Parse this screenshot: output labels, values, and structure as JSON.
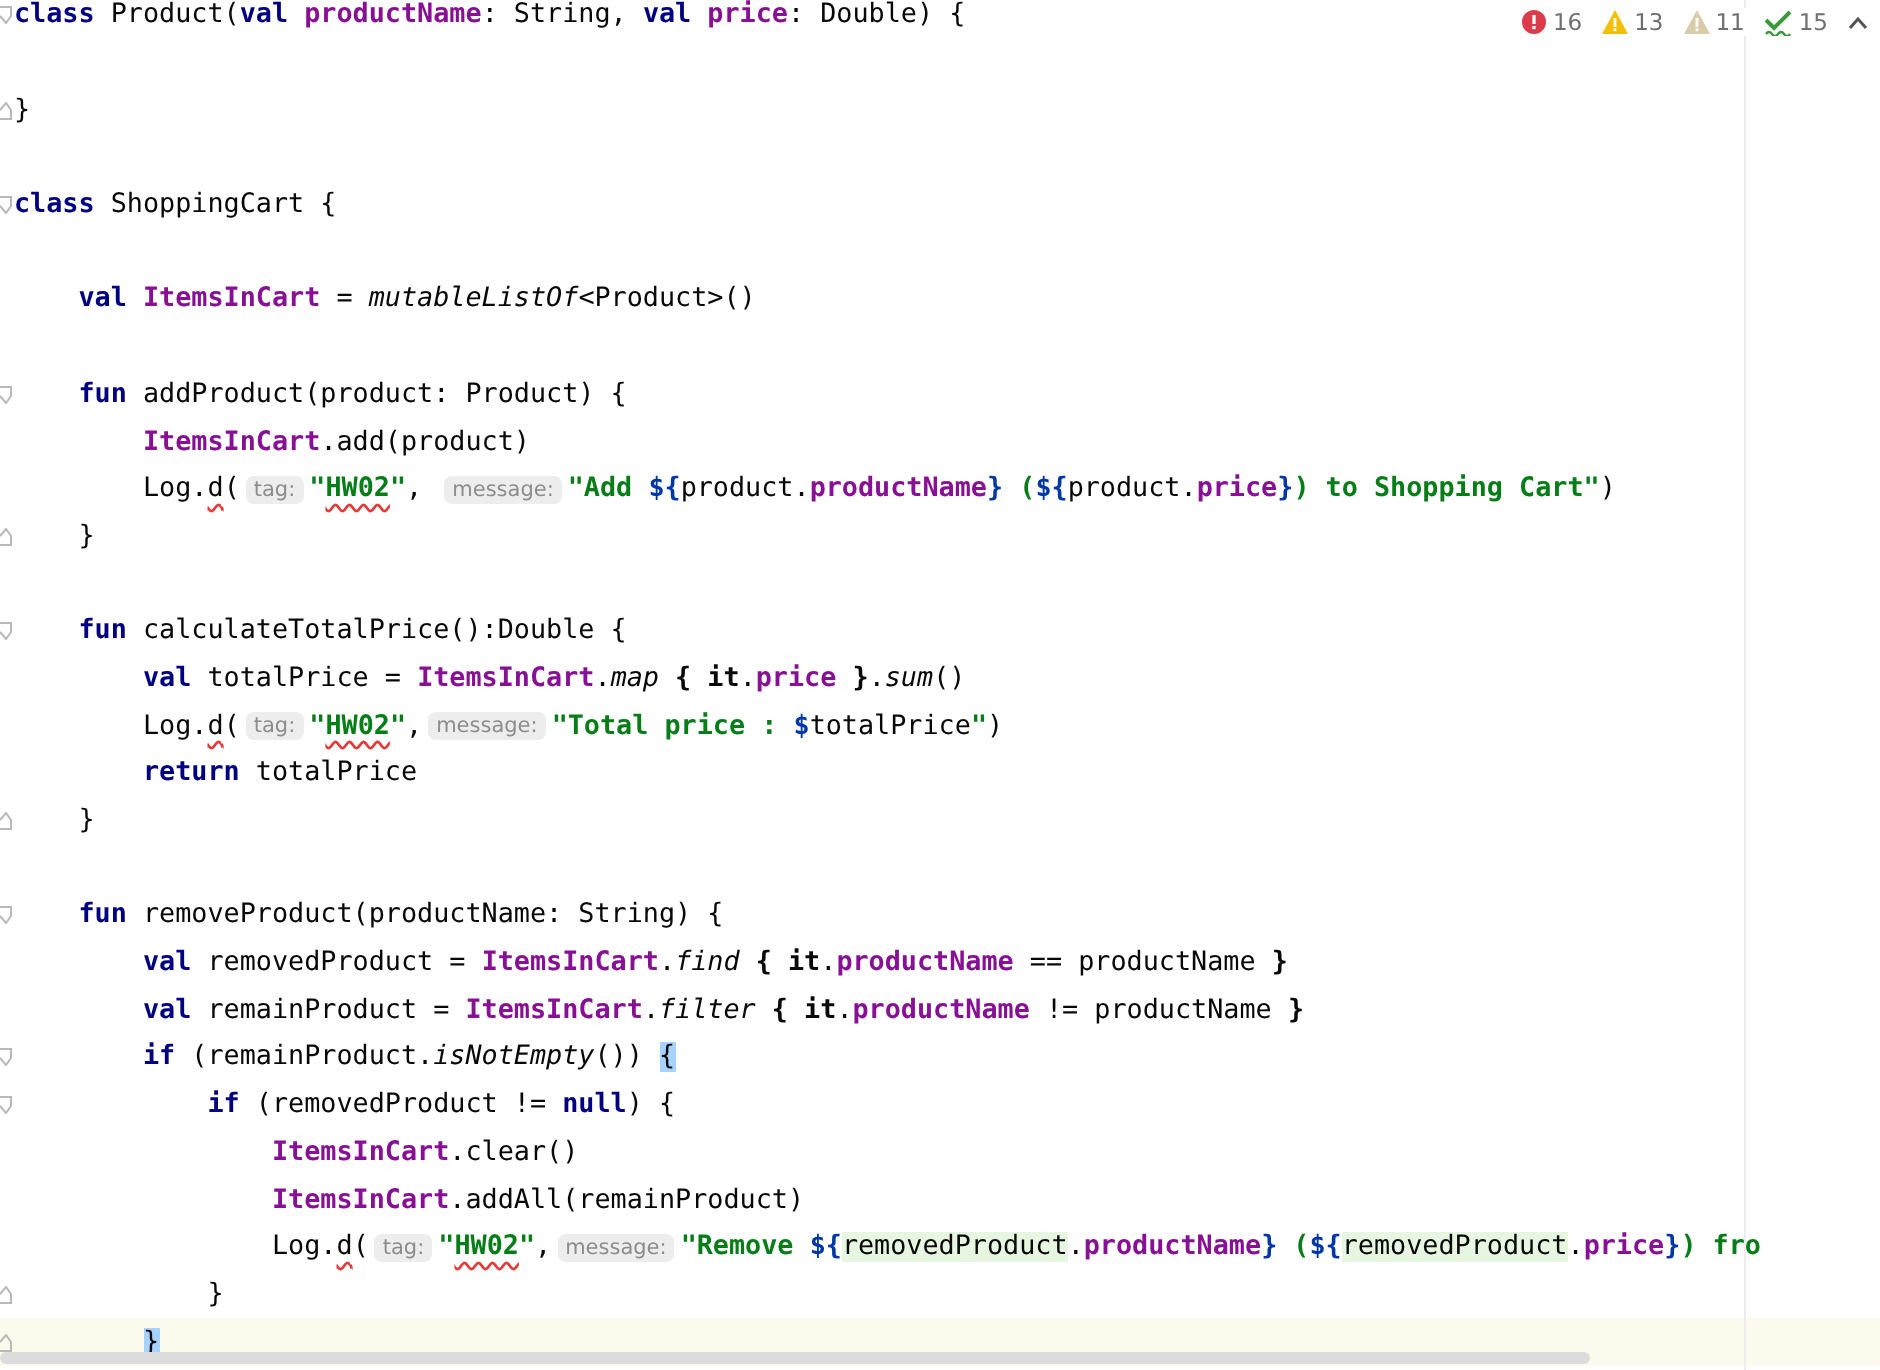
{
  "inspections": [
    {
      "kind": "error",
      "count": "16"
    },
    {
      "kind": "warning",
      "count": "13"
    },
    {
      "kind": "weak",
      "count": "11"
    },
    {
      "kind": "typo",
      "count": "15"
    }
  ],
  "lines": [
    {
      "fold_start": true,
      "fold_end": false,
      "current": false,
      "tokens": [
        {
          "kind": "kw",
          "text": "class"
        },
        {
          "kind": "plain",
          "text": " Product("
        },
        {
          "kind": "kw",
          "text": "val"
        },
        {
          "kind": "member",
          "text": " productName"
        },
        {
          "kind": "plain",
          "text": ": String, "
        },
        {
          "kind": "kw",
          "text": "val"
        },
        {
          "kind": "member",
          "text": " price"
        },
        {
          "kind": "plain",
          "text": ": Double) {"
        }
      ]
    },
    {
      "fold_start": false,
      "fold_end": false,
      "current": false
    },
    {
      "fold_start": false,
      "fold_end": true,
      "current": false,
      "tokens": [
        {
          "kind": "plain",
          "text": "}"
        }
      ]
    },
    {
      "fold_start": false,
      "fold_end": false,
      "current": false
    },
    {
      "fold_start": true,
      "fold_end": false,
      "current": false,
      "tokens": [
        {
          "kind": "kw",
          "text": "class"
        },
        {
          "kind": "plain",
          "text": " ShoppingCart {"
        }
      ]
    },
    {
      "fold_start": false,
      "fold_end": false,
      "current": false
    },
    {
      "fold_start": false,
      "fold_end": false,
      "current": false,
      "tokens": [
        {
          "kind": "kw",
          "text": "    val"
        },
        {
          "kind": "member",
          "text": " ItemsInCart"
        },
        {
          "kind": "plain",
          "text": " = "
        },
        {
          "kind": "italic",
          "text": "mutableListOf"
        },
        {
          "kind": "plain",
          "text": "<Product>()"
        }
      ]
    },
    {
      "fold_start": false,
      "fold_end": false,
      "current": false
    },
    {
      "fold_start": true,
      "fold_end": false,
      "current": false,
      "tokens": [
        {
          "kind": "kw",
          "text": "    fun"
        },
        {
          "kind": "plain",
          "text": " addProduct(product: Product) {"
        }
      ]
    },
    {
      "fold_start": false,
      "fold_end": false,
      "current": false,
      "tokens": [
        {
          "kind": "member",
          "text": "        ItemsInCart"
        },
        {
          "kind": "plain",
          "text": ".add(product)"
        }
      ]
    },
    {
      "fold_start": false,
      "fold_end": false,
      "current": false,
      "tokens": [
        {
          "kind": "plain",
          "text": "        Log."
        },
        {
          "kind": "error",
          "text": "d"
        },
        {
          "kind": "plain",
          "text": "("
        },
        {
          "kind": "hint",
          "text": "tag:"
        },
        {
          "kind": "str",
          "text": "\""
        },
        {
          "kind": "typo",
          "text": "HW02"
        },
        {
          "kind": "str",
          "text": "\""
        },
        {
          "kind": "plain",
          "text": ", "
        },
        {
          "kind": "hint",
          "text": "message:"
        },
        {
          "kind": "str",
          "text": "\"Add "
        },
        {
          "kind": "tmpl",
          "text": "${"
        },
        {
          "kind": "plain",
          "text": "product."
        },
        {
          "kind": "member",
          "text": "productName"
        },
        {
          "kind": "tmpl",
          "text": "}"
        },
        {
          "kind": "str",
          "text": " ("
        },
        {
          "kind": "tmpl",
          "text": "${"
        },
        {
          "kind": "plain",
          "text": "product."
        },
        {
          "kind": "member",
          "text": "price"
        },
        {
          "kind": "tmpl",
          "text": "}"
        },
        {
          "kind": "str",
          "text": ") to Shopping Cart\""
        },
        {
          "kind": "plain",
          "text": ")"
        }
      ]
    },
    {
      "fold_start": false,
      "fold_end": true,
      "current": false,
      "tokens": [
        {
          "kind": "plain",
          "text": "    }"
        }
      ]
    },
    {
      "fold_start": false,
      "fold_end": false,
      "current": false
    },
    {
      "fold_start": true,
      "fold_end": false,
      "current": false,
      "tokens": [
        {
          "kind": "kw",
          "text": "    fun"
        },
        {
          "kind": "plain",
          "text": " calculateTotalPrice():Double {"
        }
      ]
    },
    {
      "fold_start": false,
      "fold_end": false,
      "current": false,
      "tokens": [
        {
          "kind": "kw",
          "text": "        val"
        },
        {
          "kind": "plain",
          "text": " totalPrice = "
        },
        {
          "kind": "member",
          "text": "ItemsInCart"
        },
        {
          "kind": "plain",
          "text": "."
        },
        {
          "kind": "italic",
          "text": "map"
        },
        {
          "kind": "bold",
          "text": " { it"
        },
        {
          "kind": "plain",
          "text": "."
        },
        {
          "kind": "member",
          "text": "price"
        },
        {
          "kind": "bold",
          "text": " }"
        },
        {
          "kind": "plain",
          "text": "."
        },
        {
          "kind": "italic",
          "text": "sum"
        },
        {
          "kind": "plain",
          "text": "()"
        }
      ]
    },
    {
      "fold_start": false,
      "fold_end": false,
      "current": false,
      "tokens": [
        {
          "kind": "plain",
          "text": "        Log."
        },
        {
          "kind": "error",
          "text": "d"
        },
        {
          "kind": "plain",
          "text": "("
        },
        {
          "kind": "hint",
          "text": "tag:"
        },
        {
          "kind": "str",
          "text": "\""
        },
        {
          "kind": "typo",
          "text": "HW02"
        },
        {
          "kind": "str",
          "text": "\""
        },
        {
          "kind": "plain",
          "text": ","
        },
        {
          "kind": "hint",
          "text": "message:"
        },
        {
          "kind": "str",
          "text": "\"Total price : "
        },
        {
          "kind": "tmpl",
          "text": "$"
        },
        {
          "kind": "plain",
          "text": "totalPrice"
        },
        {
          "kind": "str",
          "text": "\""
        },
        {
          "kind": "plain",
          "text": ")"
        }
      ]
    },
    {
      "fold_start": false,
      "fold_end": false,
      "current": false,
      "tokens": [
        {
          "kind": "kw",
          "text": "        return"
        },
        {
          "kind": "plain",
          "text": " totalPrice"
        }
      ]
    },
    {
      "fold_start": false,
      "fold_end": true,
      "current": false,
      "tokens": [
        {
          "kind": "plain",
          "text": "    }"
        }
      ]
    },
    {
      "fold_start": false,
      "fold_end": false,
      "current": false
    },
    {
      "fold_start": true,
      "fold_end": false,
      "current": false,
      "tokens": [
        {
          "kind": "kw",
          "text": "    fun"
        },
        {
          "kind": "plain",
          "text": " removeProduct(productName: String) {"
        }
      ]
    },
    {
      "fold_start": false,
      "fold_end": false,
      "current": false,
      "tokens": [
        {
          "kind": "kw",
          "text": "        val"
        },
        {
          "kind": "plain",
          "text": " removedProduct = "
        },
        {
          "kind": "member",
          "text": "ItemsInCart"
        },
        {
          "kind": "plain",
          "text": "."
        },
        {
          "kind": "italic",
          "text": "find"
        },
        {
          "kind": "bold",
          "text": " { it"
        },
        {
          "kind": "plain",
          "text": "."
        },
        {
          "kind": "member",
          "text": "productName"
        },
        {
          "kind": "plain",
          "text": " == productName "
        },
        {
          "kind": "bold",
          "text": "}"
        }
      ]
    },
    {
      "fold_start": false,
      "fold_end": false,
      "current": false,
      "tokens": [
        {
          "kind": "kw",
          "text": "        val"
        },
        {
          "kind": "plain",
          "text": " remainProduct = "
        },
        {
          "kind": "member",
          "text": "ItemsInCart"
        },
        {
          "kind": "plain",
          "text": "."
        },
        {
          "kind": "italic",
          "text": "filter"
        },
        {
          "kind": "bold",
          "text": " { it"
        },
        {
          "kind": "plain",
          "text": "."
        },
        {
          "kind": "member",
          "text": "productName"
        },
        {
          "kind": "plain",
          "text": " != productName "
        },
        {
          "kind": "bold",
          "text": "}"
        }
      ]
    },
    {
      "fold_start": true,
      "fold_end": false,
      "current": false,
      "tokens": [
        {
          "kind": "kw",
          "text": "        if"
        },
        {
          "kind": "plain",
          "text": " (remainProduct."
        },
        {
          "kind": "italic",
          "text": "isNotEmpty"
        },
        {
          "kind": "plain",
          "text": "()) "
        },
        {
          "kind": "brace",
          "text": "{"
        }
      ]
    },
    {
      "fold_start": true,
      "fold_end": false,
      "current": false,
      "tokens": [
        {
          "kind": "kw",
          "text": "            if"
        },
        {
          "kind": "plain",
          "text": " (removedProduct != "
        },
        {
          "kind": "kw",
          "text": "null"
        },
        {
          "kind": "plain",
          "text": ") {"
        }
      ]
    },
    {
      "fold_start": false,
      "fold_end": false,
      "current": false,
      "tokens": [
        {
          "kind": "member",
          "text": "                ItemsInCart"
        },
        {
          "kind": "plain",
          "text": ".clear()"
        }
      ]
    },
    {
      "fold_start": false,
      "fold_end": false,
      "current": false,
      "tokens": [
        {
          "kind": "member",
          "text": "                ItemsInCart"
        },
        {
          "kind": "plain",
          "text": ".addAll(remainProduct)"
        }
      ]
    },
    {
      "fold_start": false,
      "fold_end": false,
      "current": false,
      "tokens": [
        {
          "kind": "plain",
          "text": "                Log."
        },
        {
          "kind": "error",
          "text": "d"
        },
        {
          "kind": "plain",
          "text": "("
        },
        {
          "kind": "hint",
          "text": "tag:"
        },
        {
          "kind": "str",
          "text": "\""
        },
        {
          "kind": "typo",
          "text": "HW02"
        },
        {
          "kind": "str",
          "text": "\""
        },
        {
          "kind": "plain",
          "text": ","
        },
        {
          "kind": "hint",
          "text": "message:"
        },
        {
          "kind": "str",
          "text": "\"Remove "
        },
        {
          "kind": "tmpl",
          "text": "${"
        },
        {
          "kind": "hl",
          "text": "removedProduct"
        },
        {
          "kind": "plain",
          "text": "."
        },
        {
          "kind": "member",
          "text": "productName"
        },
        {
          "kind": "tmpl",
          "text": "}"
        },
        {
          "kind": "str",
          "text": " ("
        },
        {
          "kind": "tmpl",
          "text": "${"
        },
        {
          "kind": "hl",
          "text": "removedProduct"
        },
        {
          "kind": "plain",
          "text": "."
        },
        {
          "kind": "member",
          "text": "price"
        },
        {
          "kind": "tmpl",
          "text": "}"
        },
        {
          "kind": "str",
          "text": ") fro"
        }
      ]
    },
    {
      "fold_start": false,
      "fold_end": true,
      "current": false,
      "tokens": [
        {
          "kind": "plain",
          "text": "            }"
        }
      ]
    },
    {
      "fold_start": false,
      "fold_end": true,
      "current": true,
      "tokens": [
        {
          "kind": "brace",
          "text": "        }"
        }
      ]
    }
  ]
}
